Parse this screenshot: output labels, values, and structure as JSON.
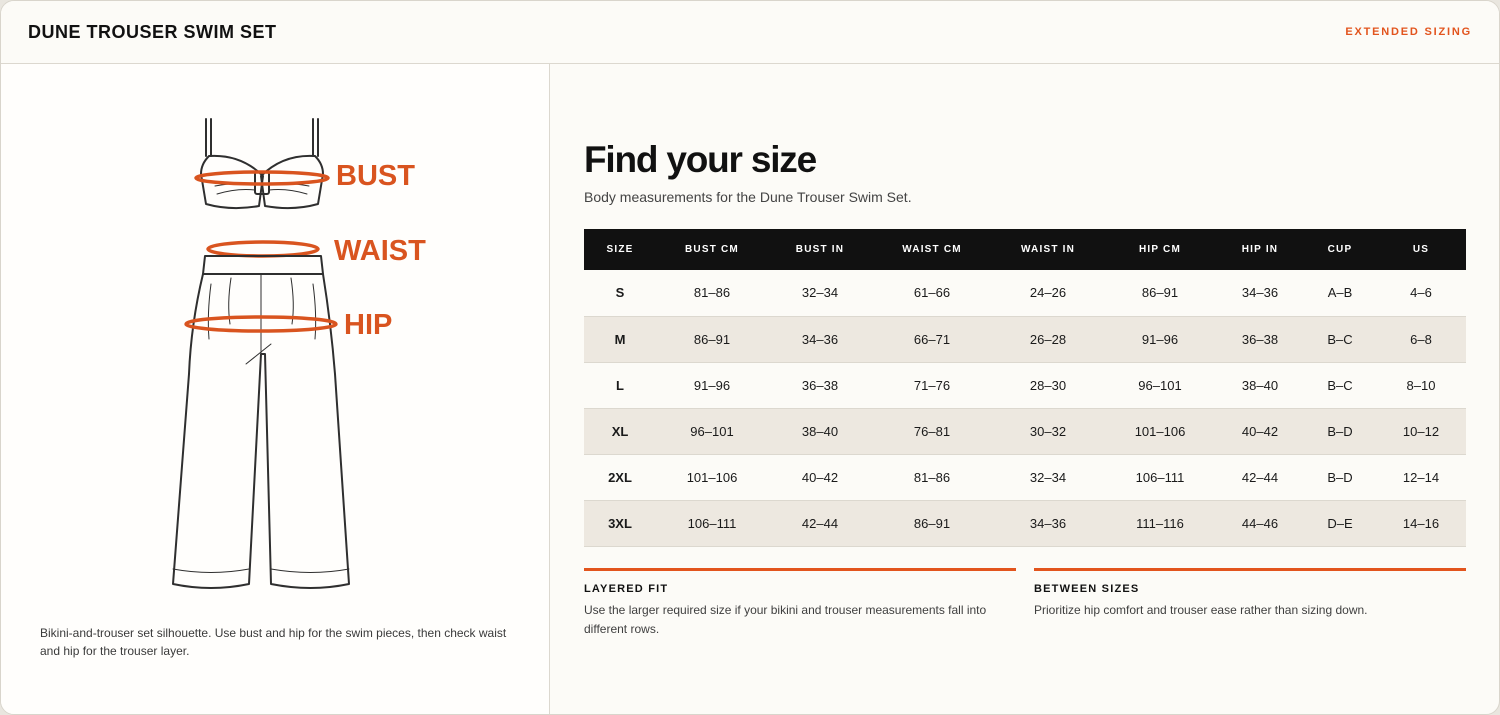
{
  "header": {
    "title": "DUNE TROUSER SWIM SET",
    "extended_label": "EXTENDED SIZING"
  },
  "illustration": {
    "labels": {
      "bust": "BUST",
      "waist": "WAIST",
      "hip": "HIP"
    },
    "caption": "Bikini-and-trouser set silhouette. Use bust and hip for the swim pieces, then check waist and hip for the trouser layer."
  },
  "main": {
    "heading": "Find your size",
    "subheading": "Body measurements for the Dune Trouser Swim Set."
  },
  "table": {
    "headers": [
      "SIZE",
      "BUST CM",
      "BUST IN",
      "WAIST CM",
      "WAIST IN",
      "HIP CM",
      "HIP IN",
      "CUP",
      "US"
    ],
    "rows": [
      [
        "S",
        "81–86",
        "32–34",
        "61–66",
        "24–26",
        "86–91",
        "34–36",
        "A–B",
        "4–6"
      ],
      [
        "M",
        "86–91",
        "34–36",
        "66–71",
        "26–28",
        "91–96",
        "36–38",
        "B–C",
        "6–8"
      ],
      [
        "L",
        "91–96",
        "36–38",
        "71–76",
        "28–30",
        "96–101",
        "38–40",
        "B–C",
        "8–10"
      ],
      [
        "XL",
        "96–101",
        "38–40",
        "76–81",
        "30–32",
        "101–106",
        "40–42",
        "B–D",
        "10–12"
      ],
      [
        "2XL",
        "101–106",
        "40–42",
        "81–86",
        "32–34",
        "106–111",
        "42–44",
        "B–D",
        "12–14"
      ],
      [
        "3XL",
        "106–111",
        "42–44",
        "86–91",
        "34–36",
        "111–116",
        "44–46",
        "D–E",
        "14–16"
      ]
    ]
  },
  "notes": [
    {
      "title": "LAYERED FIT",
      "body": "Use the larger required size if your bikini and trouser measurements fall into different rows."
    },
    {
      "title": "BETWEEN SIZES",
      "body": "Prioritize hip comfort and trouser ease rather than sizing down."
    }
  ],
  "colors": {
    "accent": "#e2541d",
    "header_bg": "#111111",
    "alt_row": "#ede8e0"
  },
  "icons": {
    "garment": "bikini-trouser-silhouette-icon"
  }
}
